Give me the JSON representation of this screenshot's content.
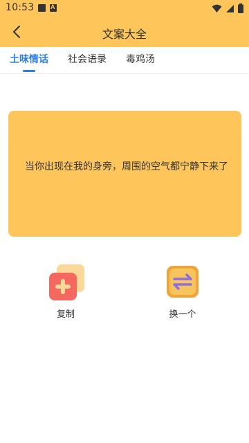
{
  "status_bar": {
    "time": "10:53",
    "left_icons": [
      "image-icon",
      "a-letter-icon"
    ],
    "right_icons": [
      "wifi-icon",
      "signal-icon",
      "battery-icon"
    ]
  },
  "header": {
    "title": "文案大全",
    "back_icon": "chevron-left-icon"
  },
  "tabs": [
    {
      "label": "土味情话",
      "active": true
    },
    {
      "label": "社会语录",
      "active": false
    },
    {
      "label": "毒鸡汤",
      "active": false
    }
  ],
  "quote": {
    "text": "当你出现在我的身旁，周围的空气都宁静下来了"
  },
  "actions": {
    "copy": {
      "label": "复制",
      "icon": "copy-plus-icon"
    },
    "change": {
      "label": "换一个",
      "icon": "swap-arrows-icon"
    }
  },
  "colors": {
    "brand": "#FDC55A",
    "tab_active": "#2B7DE9",
    "copy_icon_red": "#F4685F",
    "copy_icon_back": "#FCD99A",
    "change_icon_orange": "#F0A43A",
    "change_icon_purple": "#8E6FE0"
  }
}
